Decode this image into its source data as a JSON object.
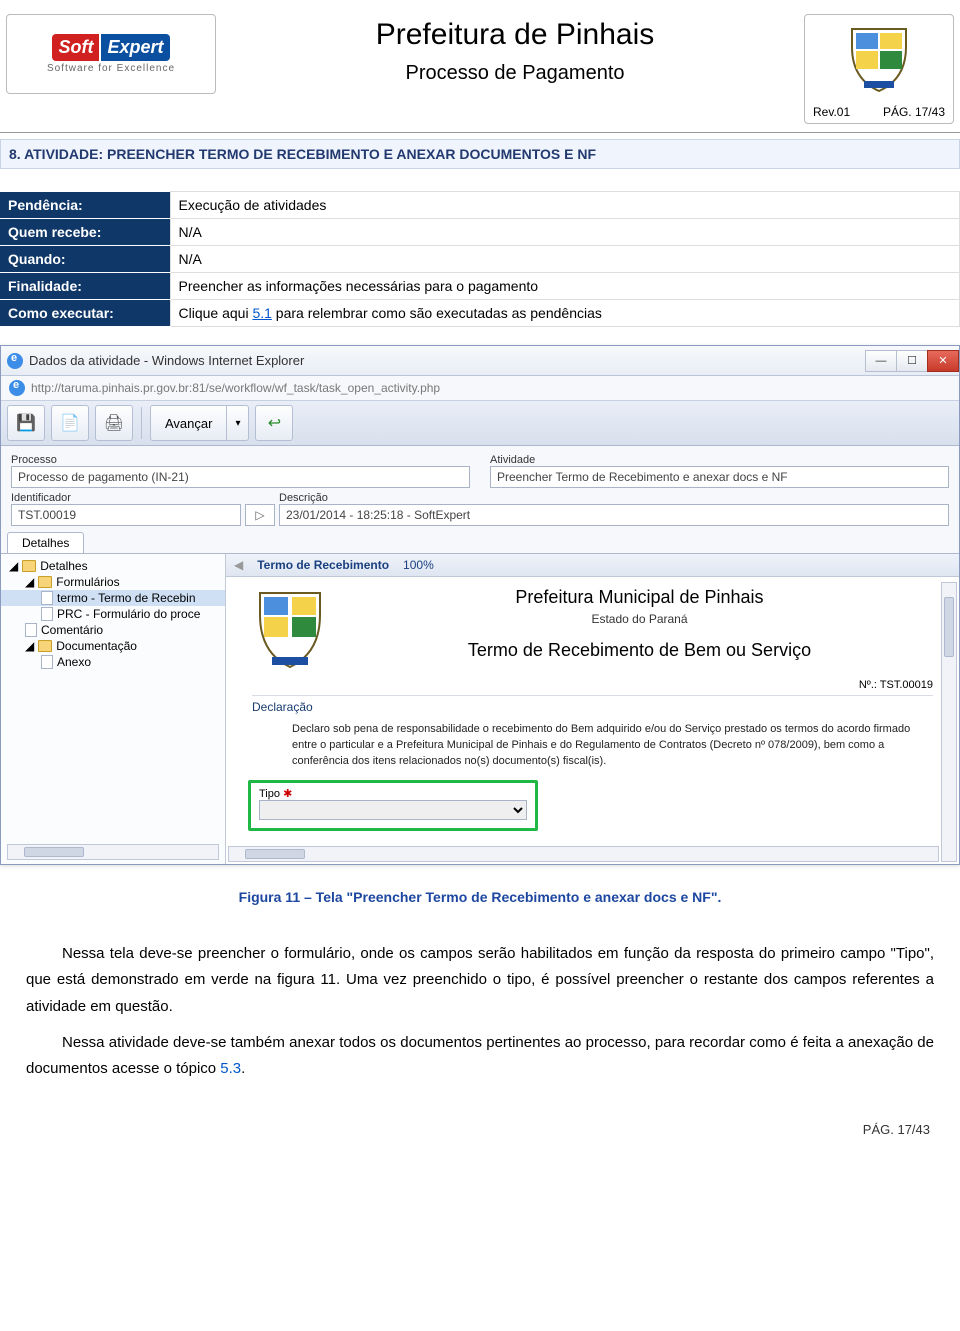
{
  "header": {
    "logo_soft": "Soft",
    "logo_expert": "Expert",
    "logo_sub": "Software for Excellence",
    "title": "Prefeitura de Pinhais",
    "subtitle": "Processo de Pagamento",
    "rev": "Rev.01",
    "pag": "PÁG. 17/43"
  },
  "section": {
    "num": "8.",
    "title": "ATIVIDADE: PREENCHER TERMO DE RECEBIMENTO E ANEXAR DOCUMENTOS E NF"
  },
  "info": {
    "rows": [
      {
        "label": "Pendência:",
        "value": "Execução de atividades"
      },
      {
        "label": "Quem recebe:",
        "value": "N/A"
      },
      {
        "label": "Quando:",
        "value": "N/A"
      },
      {
        "label": "Finalidade:",
        "value": "Preencher as informações necessárias para o pagamento"
      }
    ],
    "exec_label": "Como executar:",
    "exec_pre": "Clique aqui ",
    "exec_link": "5.1",
    "exec_post": " para relembrar como são executadas as pendências"
  },
  "window": {
    "title": "Dados da atividade - Windows Internet Explorer",
    "url": "http://taruma.pinhais.pr.gov.br:81/se/workflow/wf_task/task_open_activity.php",
    "advance": "Avançar",
    "fields": {
      "processo_label": "Processo",
      "processo_value": "Processo de pagamento (IN-21)",
      "atividade_label": "Atividade",
      "atividade_value": "Preencher Termo de Recebimento e anexar docs e NF",
      "ident_label": "Identificador",
      "ident_value": "TST.00019",
      "desc_label": "Descrição",
      "desc_value": "23/01/2014 - 18:25:18 - SoftExpert"
    },
    "tab": "Detalhes",
    "tree": {
      "detalhes": "Detalhes",
      "form": "Formulários",
      "termo": "termo - Termo de Recebin",
      "prc": "PRC - Formulário do proce",
      "comentario": "Comentário",
      "docum": "Documentação",
      "anexo": "Anexo"
    },
    "form": {
      "toolbar_title": "Termo de Recebimento",
      "pct": "100%",
      "t1": "Prefeitura Municipal de Pinhais",
      "t2": "Estado do Paraná",
      "t3": "Termo de Recebimento de Bem ou Serviço",
      "num": "Nº.: TST.00019",
      "decl_label": "Declaração",
      "decl_text": "Declaro sob pena de responsabilidade o recebimento do Bem adquirido e/ou do Serviço prestado os termos do acordo firmado entre o particular e a Prefeitura Municipal de Pinhais e do Regulamento de Contratos (Decreto nº 078/2009), bem como a conferência dos itens relacionados no(s) documento(s) fiscal(is).",
      "tipo_label": "Tipo",
      "tipo_req": "✱"
    }
  },
  "caption": "Figura 11 – Tela \"Preencher Termo de Recebimento e anexar docs e NF\".",
  "body": {
    "p1a": "Nessa tela deve-se preencher o formulário, onde os campos serão habilitados em função da resposta do primeiro campo \"Tipo\", que está demonstrado em verde na figura 11. Uma vez preenchido o tipo, é possível preencher o restante dos campos referentes a atividade em questão.",
    "p2a": "Nessa atividade deve-se também anexar todos os documentos pertinentes ao processo, para recordar como é feita a anexação de documentos acesse o tópico ",
    "p2link": "5.3",
    "p2b": "."
  },
  "footer": "PÁG. 17/43"
}
